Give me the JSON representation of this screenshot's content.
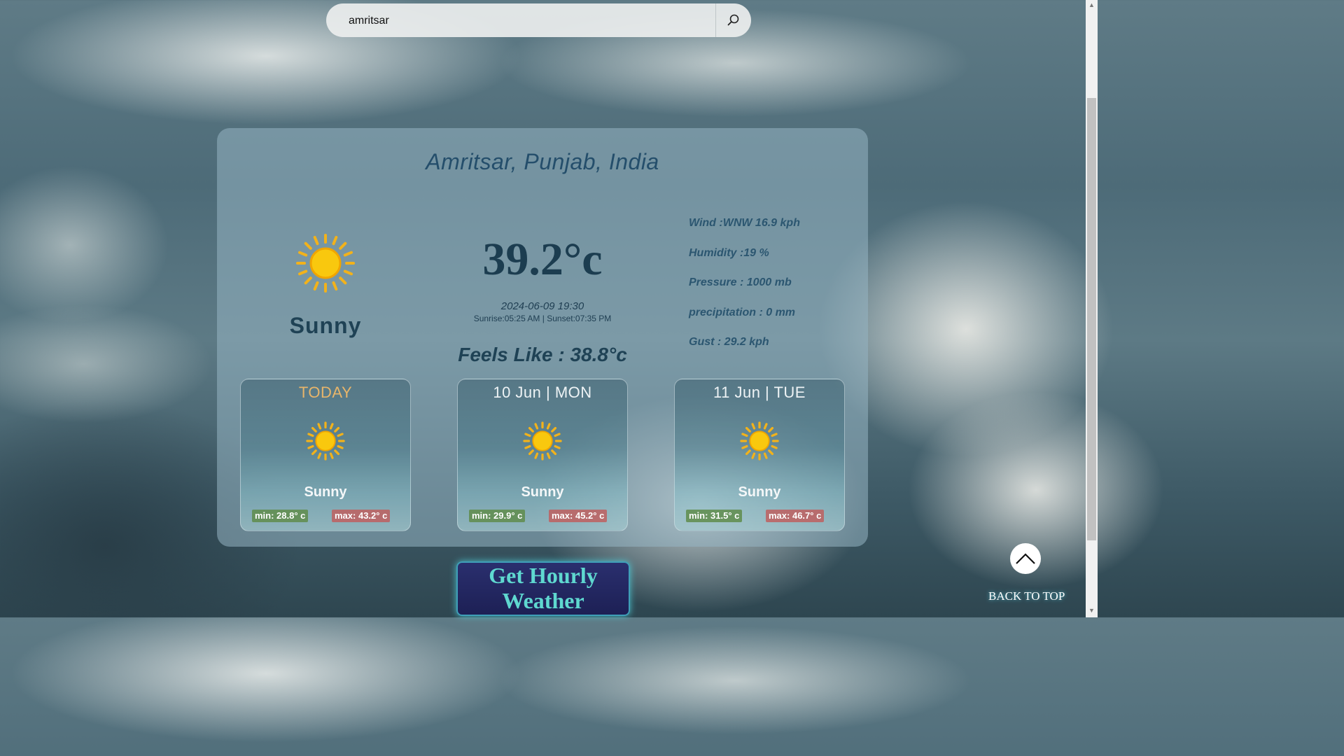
{
  "search": {
    "value": "amritsar",
    "button_icon": "search-icon"
  },
  "current": {
    "location": "Amritsar, Punjab, India",
    "condition": "Sunny",
    "temperature": "39.2°c",
    "datetime": "2024-06-09 19:30",
    "sun_times": "Sunrise:05:25 AM | Sunset:07:35 PM",
    "feels_like": "Feels Like : 38.8°c",
    "icon": "sun-icon"
  },
  "stats": {
    "wind": "Wind :WNW 16.9 kph",
    "humidity": "Humidity :19 %",
    "pressure": "Pressure : 1000 mb",
    "precipitation": "precipitation : 0 mm",
    "gust": "Gust : 29.2 kph"
  },
  "forecast": [
    {
      "day": "TODAY",
      "condition": "Sunny",
      "min": "min: 28.8° c",
      "max": "max: 43.2° c",
      "icon": "sun-icon"
    },
    {
      "day": "10 Jun | MON",
      "condition": "Sunny",
      "min": "min: 29.9° c",
      "max": "max: 45.2° c",
      "icon": "sun-icon"
    },
    {
      "day": "11 Jun | TUE",
      "condition": "Sunny",
      "min": "min: 31.5° c",
      "max": "max: 46.7° c",
      "icon": "sun-icon"
    }
  ],
  "hourly_button": {
    "line1": "Get Hourly",
    "line2": "Weather"
  },
  "back_to_top": {
    "label": "BACK TO TOP",
    "icon": "chevron-up-icon"
  },
  "colors": {
    "accent_today": "#e8b56a",
    "min_badge": "#5f8c4b",
    "max_badge": "#be5f5f",
    "glow": "#5fd8d0"
  }
}
